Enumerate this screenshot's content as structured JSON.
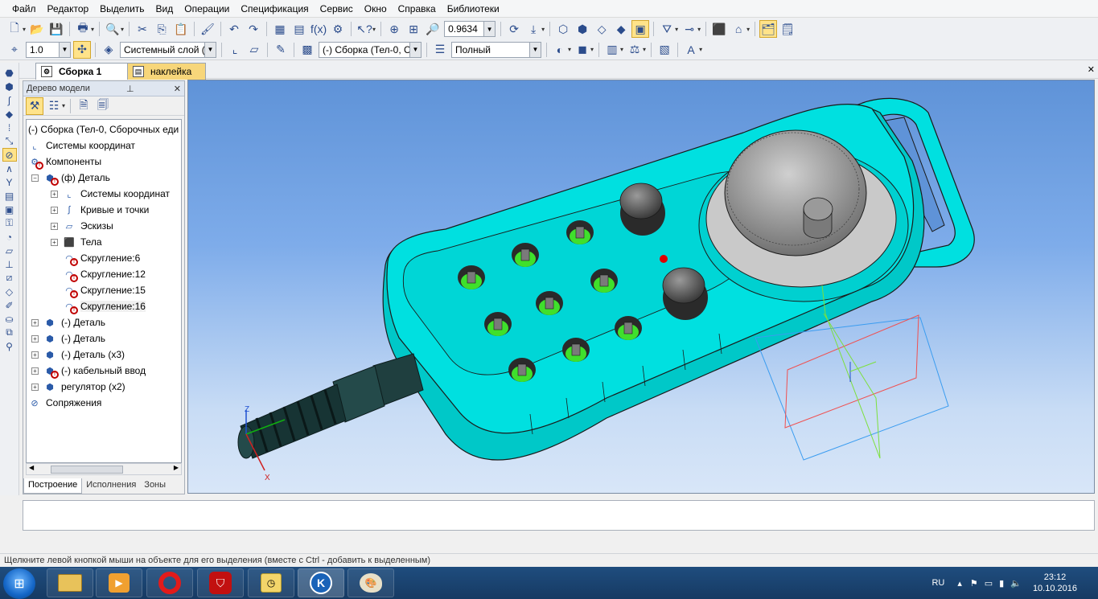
{
  "menu": [
    "Файл",
    "Редактор",
    "Выделить",
    "Вид",
    "Операции",
    "Спецификация",
    "Сервис",
    "Окно",
    "Справка",
    "Библиотеки"
  ],
  "toolbar1": {
    "zoom_value": "0.9634"
  },
  "toolbar2": {
    "step_value": "1.0",
    "layer_value": "Системный слой (0)",
    "assembly_value": "(-) Сборка (Тел-0, С",
    "mode_value": "Полный"
  },
  "doc_tabs": [
    {
      "label": "Сборка 1"
    },
    {
      "label": "наклейка"
    }
  ],
  "tree_panel": {
    "title": "Дерево модели",
    "items": [
      {
        "label": "(-) Сборка (Тел-0, Сборочных еди"
      },
      {
        "label": "Системы координат"
      },
      {
        "label": "Компоненты"
      },
      {
        "label": "(ф) Деталь"
      },
      {
        "label": "Системы координат"
      },
      {
        "label": "Кривые и точки"
      },
      {
        "label": "Эскизы"
      },
      {
        "label": "Тела"
      },
      {
        "label": "Скругление:6"
      },
      {
        "label": "Скругление:12"
      },
      {
        "label": "Скругление:15"
      },
      {
        "label": "Скругление:16"
      },
      {
        "label": "(-) Деталь"
      },
      {
        "label": "(-) Деталь"
      },
      {
        "label": "(-) Деталь (x3)"
      },
      {
        "label": "(-) кабельный ввод"
      },
      {
        "label": "регулятор (x2)"
      },
      {
        "label": "Сопряжения"
      }
    ],
    "tabs": [
      "Построение",
      "Исполнения",
      "Зоны"
    ]
  },
  "viewport": {
    "axis_z": "Z",
    "axis_x": "X"
  },
  "status_text": "Щелкните левой кнопкой мыши на объекте для его выделения (вместе с Ctrl - добавить к выделенным)",
  "taskbar": {
    "lang": "RU",
    "time": "23:12",
    "date": "10.10.2016"
  },
  "colors": {
    "model": "#00e0e0",
    "button_green": "#3fe02c",
    "viewport_top": "#5f93d8",
    "selected_tool": "#ffe38a"
  }
}
